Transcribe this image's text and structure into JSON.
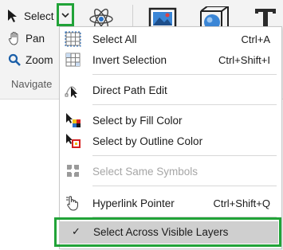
{
  "ribbon": {
    "select_label": "Select",
    "pan_label": "Pan",
    "zoom_label": "Zoom",
    "group_label": "Navigate"
  },
  "menu": {
    "select_all": {
      "label": "Select All",
      "shortcut": "Ctrl+A",
      "icon": "grid-select-icon"
    },
    "invert_selection": {
      "label": "Invert Selection",
      "shortcut": "Ctrl+Shift+I",
      "icon": "invert-grid-icon"
    },
    "direct_path_edit": {
      "label": "Direct Path Edit",
      "icon": "path-arrow-icon"
    },
    "select_by_fill": {
      "label": "Select by Fill Color",
      "icon": "fill-color-arrow-icon"
    },
    "select_by_outline": {
      "label": "Select by Outline Color",
      "icon": "outline-color-arrow-icon"
    },
    "select_same_symbols": {
      "label": "Select Same Symbols",
      "icon": "symbols-icon",
      "disabled": true
    },
    "hyperlink_pointer": {
      "label": "Hyperlink Pointer",
      "shortcut": "Ctrl+Shift+Q",
      "icon": "hand-pointer-icon"
    },
    "select_across_layers": {
      "label": "Select Across Visible Layers",
      "checked": true,
      "check": "✓"
    }
  },
  "colors": {
    "highlight_border": "#21a338",
    "highlight_fill": "#cfcfcf",
    "disabled_text": "#a6a6a6"
  }
}
